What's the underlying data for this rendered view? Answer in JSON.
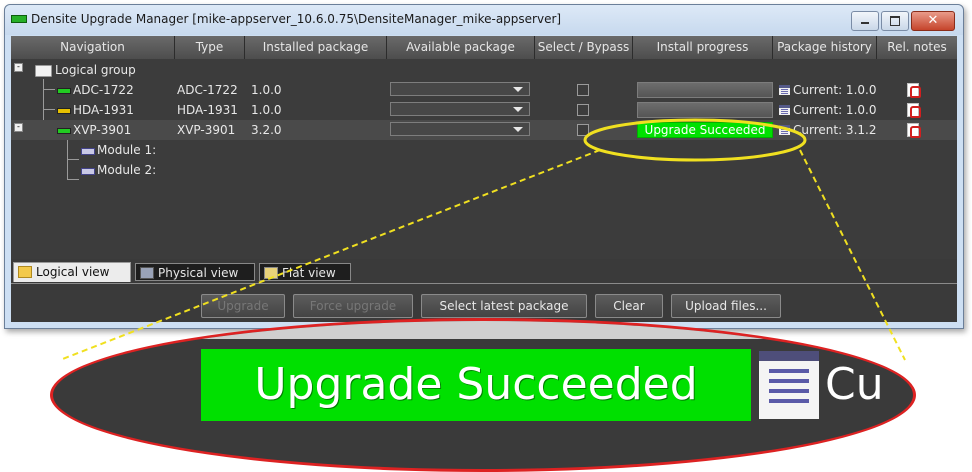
{
  "window": {
    "title": "Densite Upgrade Manager [mike-appserver_10.6.0.75\\DensiteManager_mike-appserver]",
    "close_glyph": "✕"
  },
  "columns": [
    "Navigation",
    "Type",
    "Installed package",
    "Available package",
    "Select / Bypass",
    "Install progress",
    "Package history",
    "Rel. notes"
  ],
  "tree": {
    "root_label": "Logical group",
    "rows": [
      {
        "name": "ADC-1722",
        "type": "ADC-1722",
        "installed": "1.0.0",
        "progress": "",
        "history": "Current: 1.0.0",
        "status_color": "#22cc22"
      },
      {
        "name": "HDA-1931",
        "type": "HDA-1931",
        "installed": "1.0.0",
        "progress": "",
        "history": "Current: 1.0.0",
        "status_color": "#e6c000"
      },
      {
        "name": "XVP-3901",
        "type": "XVP-3901",
        "installed": "3.2.0",
        "progress": "Upgrade Succeeded",
        "history": "Current: 3.1.2",
        "status_color": "#22cc22"
      }
    ],
    "modules": [
      "Module 1:",
      "Module 2:"
    ]
  },
  "tabs": [
    "Logical view",
    "Physical view",
    "Flat view"
  ],
  "buttons": {
    "upgrade": "Upgrade",
    "force_upgrade": "Force upgrade",
    "select_latest": "Select latest package",
    "clear": "Clear",
    "upload": "Upload files..."
  },
  "zoom": {
    "status": "Upgrade Succeeded",
    "history_fragment": "Cu"
  },
  "colors": {
    "success": "#00e000",
    "callout_outline": "#dd2222",
    "callout_leader": "#f0e020"
  }
}
